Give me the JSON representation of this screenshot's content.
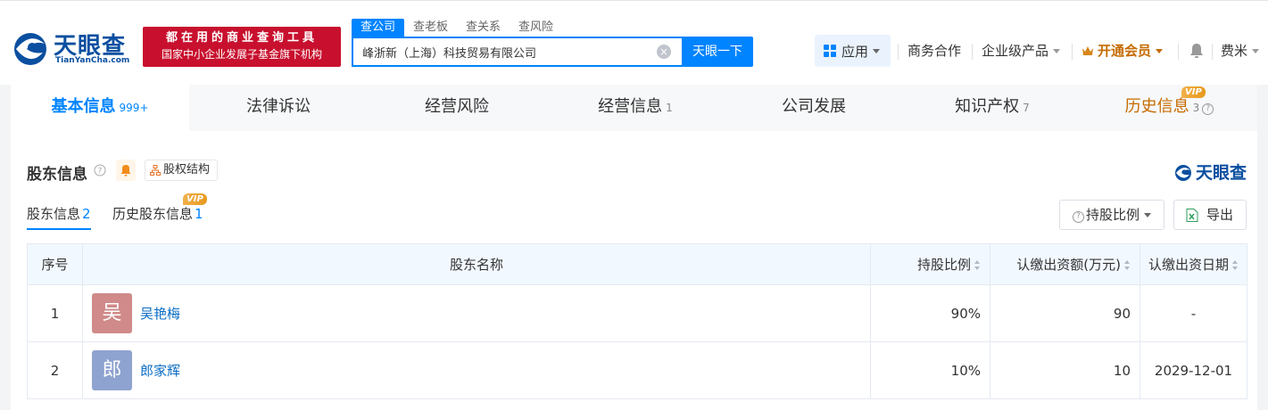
{
  "header": {
    "logo_text": "天眼查",
    "logo_sub": "TianYanCha.com",
    "slogan_line1": "都在用的商业查询工具",
    "slogan_line2": "国家中小企业发展子基金旗下机构",
    "search_tabs": [
      "查公司",
      "查老板",
      "查关系",
      "查风险"
    ],
    "search_value": "峰浙新（上海）科技贸易有限公司",
    "search_button": "天眼一下",
    "nav": {
      "apps": "应用",
      "business": "商务合作",
      "enterprise": "企业级产品",
      "vip": "开通会员",
      "user": "费米"
    }
  },
  "main_tabs": [
    {
      "label": "基本信息",
      "count": "999+"
    },
    {
      "label": "法律诉讼",
      "count": ""
    },
    {
      "label": "经营风险",
      "count": ""
    },
    {
      "label": "经营信息",
      "count": "1"
    },
    {
      "label": "公司发展",
      "count": ""
    },
    {
      "label": "知识产权",
      "count": "7"
    },
    {
      "label": "历史信息",
      "count": "3"
    }
  ],
  "vip_label": "VIP",
  "section": {
    "title": "股东信息",
    "equity_button": "股权结构",
    "brand": "天眼查",
    "subtabs": [
      {
        "label": "股东信息",
        "count": "2"
      },
      {
        "label": "历史股东信息",
        "count": "1"
      }
    ],
    "ratio_button": "持股比例",
    "export_button": "导出"
  },
  "table": {
    "headers": [
      "序号",
      "股东名称",
      "持股比例",
      "认缴出资额(万元)",
      "认缴出资日期"
    ],
    "rows": [
      {
        "idx": "1",
        "avatar": "吴",
        "avatar_color": "#d08a8a",
        "name": "吴艳梅",
        "ratio": "90%",
        "amount": "90",
        "date": "-"
      },
      {
        "idx": "2",
        "avatar": "郎",
        "avatar_color": "#8ea3cf",
        "name": "郎家辉",
        "ratio": "10%",
        "amount": "10",
        "date": "2029-12-01"
      }
    ]
  },
  "colors": {
    "primary": "#0084ff",
    "brand": "#0a4fa0",
    "slogan_bg": "#c8102e",
    "vip": "#c56a00"
  }
}
